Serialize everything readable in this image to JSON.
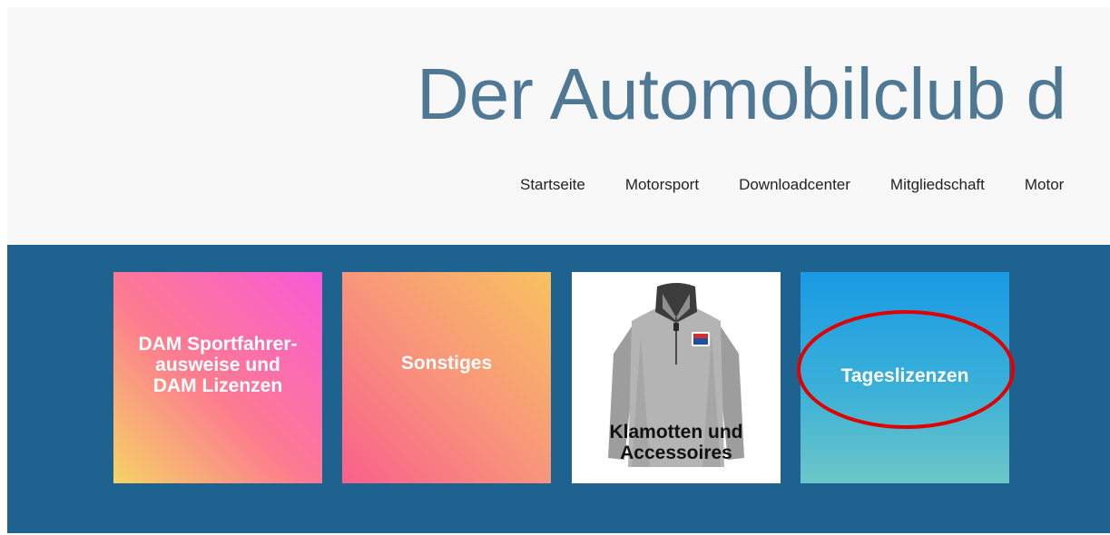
{
  "site": {
    "title": "Der Automobilclub d"
  },
  "nav": {
    "items": [
      {
        "label": "Startseite"
      },
      {
        "label": "Motorsport"
      },
      {
        "label": "Downloadcenter"
      },
      {
        "label": "Mitgliedschaft"
      },
      {
        "label": "Motor"
      }
    ]
  },
  "tiles": [
    {
      "label": "DAM Sportfahrer-ausweise und DAM Lizenzen"
    },
    {
      "label": "Sonstiges"
    },
    {
      "label": "Klamotten und Accessoires",
      "image": "jacket-image"
    },
    {
      "label": "Tageslizenzen",
      "highlighted": true
    }
  ],
  "colors": {
    "title": "#4f7894",
    "banner": "#1e628f",
    "header_bg": "#f8f8f8",
    "annotation": "#e00000"
  }
}
